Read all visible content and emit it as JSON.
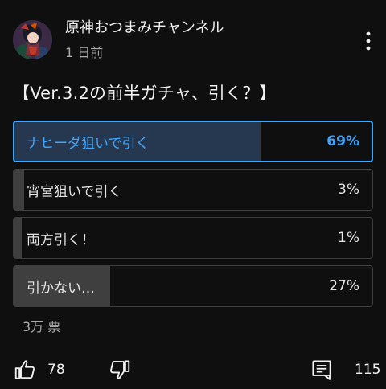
{
  "post": {
    "channel_name": "原神おつまみチャンネル",
    "time_ago": "1 日前",
    "title": "【Ver.3.2の前半ガチャ、引く？】"
  },
  "poll": {
    "accent_color": "#3ea6ff",
    "options": [
      {
        "label": "ナヒーダ狙いで引く",
        "percent": "69%",
        "share": 0.69,
        "selected": true
      },
      {
        "label": "宵宮狙いで引く",
        "percent": "3%",
        "share": 0.03,
        "selected": false
      },
      {
        "label": "両方引く！",
        "percent": "1%",
        "share": 0.01,
        "selected": false
      },
      {
        "label": "引かない…",
        "percent": "27%",
        "share": 0.27,
        "selected": false
      }
    ],
    "vote_count": "3万 票"
  },
  "actions": {
    "like_icon": "thumb-up-icon",
    "like_count": "78",
    "dislike_icon": "thumb-down-icon",
    "comment_icon": "comment-icon",
    "comment_count": "115",
    "more_icon": "more-vert-icon"
  }
}
